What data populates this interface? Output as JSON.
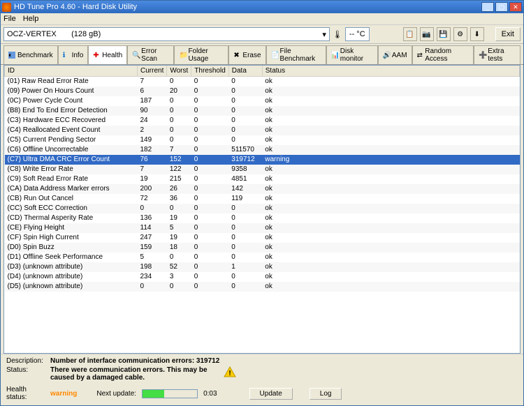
{
  "title": "HD Tune Pro 4.60 - Hard Disk Utility",
  "menu": {
    "file": "File",
    "help": "Help"
  },
  "drive": {
    "name": "OCZ-VERTEX",
    "size": "(128 gB)"
  },
  "temp": "-- °C",
  "exit": "Exit",
  "tabs": {
    "benchmark": "Benchmark",
    "info": "Info",
    "health": "Health",
    "errorscan": "Error Scan",
    "folderusage": "Folder Usage",
    "erase": "Erase",
    "filebenchmark": "File Benchmark",
    "diskmonitor": "Disk monitor",
    "aam": "AAM",
    "randomaccess": "Random Access",
    "extratests": "Extra tests"
  },
  "columns": {
    "id": "ID",
    "current": "Current",
    "worst": "Worst",
    "threshold": "Threshold",
    "data": "Data",
    "status": "Status"
  },
  "rows": [
    {
      "id": "(01) Raw Read Error Rate",
      "c": "7",
      "w": "0",
      "t": "0",
      "d": "0",
      "s": "ok"
    },
    {
      "id": "(09) Power On Hours Count",
      "c": "6",
      "w": "20",
      "t": "0",
      "d": "0",
      "s": "ok"
    },
    {
      "id": "(0C) Power Cycle Count",
      "c": "187",
      "w": "0",
      "t": "0",
      "d": "0",
      "s": "ok"
    },
    {
      "id": "(B8) End To End Error Detection",
      "c": "90",
      "w": "0",
      "t": "0",
      "d": "0",
      "s": "ok"
    },
    {
      "id": "(C3) Hardware ECC Recovered",
      "c": "24",
      "w": "0",
      "t": "0",
      "d": "0",
      "s": "ok"
    },
    {
      "id": "(C4) Reallocated Event Count",
      "c": "2",
      "w": "0",
      "t": "0",
      "d": "0",
      "s": "ok"
    },
    {
      "id": "(C5) Current Pending Sector",
      "c": "149",
      "w": "0",
      "t": "0",
      "d": "0",
      "s": "ok"
    },
    {
      "id": "(C6) Offline Uncorrectable",
      "c": "182",
      "w": "7",
      "t": "0",
      "d": "511570",
      "s": "ok"
    },
    {
      "id": "(C7) Ultra DMA CRC Error Count",
      "c": "76",
      "w": "152",
      "t": "0",
      "d": "319712",
      "s": "warning",
      "sel": true
    },
    {
      "id": "(C8) Write Error Rate",
      "c": "7",
      "w": "122",
      "t": "0",
      "d": "9358",
      "s": "ok"
    },
    {
      "id": "(C9) Soft Read Error Rate",
      "c": "19",
      "w": "215",
      "t": "0",
      "d": "4851",
      "s": "ok"
    },
    {
      "id": "(CA) Data Address Marker errors",
      "c": "200",
      "w": "26",
      "t": "0",
      "d": "142",
      "s": "ok"
    },
    {
      "id": "(CB) Run Out Cancel",
      "c": "72",
      "w": "36",
      "t": "0",
      "d": "119",
      "s": "ok"
    },
    {
      "id": "(CC) Soft ECC Correction",
      "c": "0",
      "w": "0",
      "t": "0",
      "d": "0",
      "s": "ok"
    },
    {
      "id": "(CD) Thermal Asperity Rate",
      "c": "136",
      "w": "19",
      "t": "0",
      "d": "0",
      "s": "ok"
    },
    {
      "id": "(CE) Flying Height",
      "c": "114",
      "w": "5",
      "t": "0",
      "d": "0",
      "s": "ok"
    },
    {
      "id": "(CF) Spin High Current",
      "c": "247",
      "w": "19",
      "t": "0",
      "d": "0",
      "s": "ok"
    },
    {
      "id": "(D0) Spin Buzz",
      "c": "159",
      "w": "18",
      "t": "0",
      "d": "0",
      "s": "ok"
    },
    {
      "id": "(D1) Offline Seek Performance",
      "c": "5",
      "w": "0",
      "t": "0",
      "d": "0",
      "s": "ok"
    },
    {
      "id": "(D3) (unknown attribute)",
      "c": "198",
      "w": "52",
      "t": "0",
      "d": "1",
      "s": "ok"
    },
    {
      "id": "(D4) (unknown attribute)",
      "c": "234",
      "w": "3",
      "t": "0",
      "d": "0",
      "s": "ok"
    },
    {
      "id": "(D5) (unknown attribute)",
      "c": "0",
      "w": "0",
      "t": "0",
      "d": "0",
      "s": "ok"
    }
  ],
  "footer": {
    "desc_label": "Description:",
    "desc": "Number of interface communication errors: 319712",
    "status_label": "Status:",
    "status": "There were communication errors. This may be caused by a damaged cable.",
    "health_label": "Health status:",
    "health": "warning",
    "next_label": "Next update:",
    "next_val": "0:03",
    "update": "Update",
    "log": "Log"
  }
}
